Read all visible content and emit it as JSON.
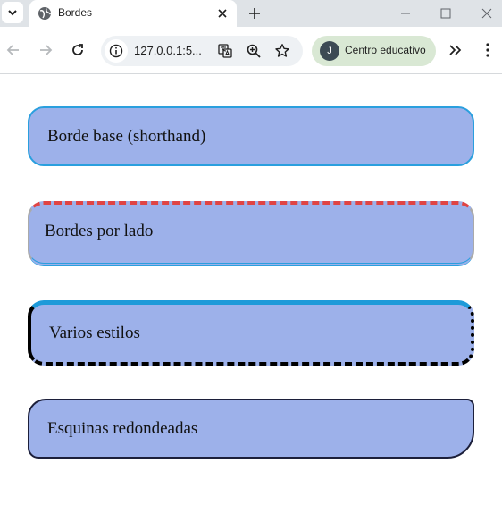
{
  "browser": {
    "tab_title": "Bordes",
    "url": "127.0.0.1:5...",
    "profile_initial": "J",
    "profile_name": "Centro educativo"
  },
  "page": {
    "boxes": [
      {
        "label": "Borde base (shorthand)"
      },
      {
        "label": "Bordes por lado"
      },
      {
        "label": "Varios estilos"
      },
      {
        "label": "Esquinas redondeadas"
      }
    ]
  },
  "colors": {
    "box_background": "#9db1ea",
    "border_blue": "#2a9fde",
    "border_red": "#e04444",
    "border_dark": "#1c1f3a"
  }
}
